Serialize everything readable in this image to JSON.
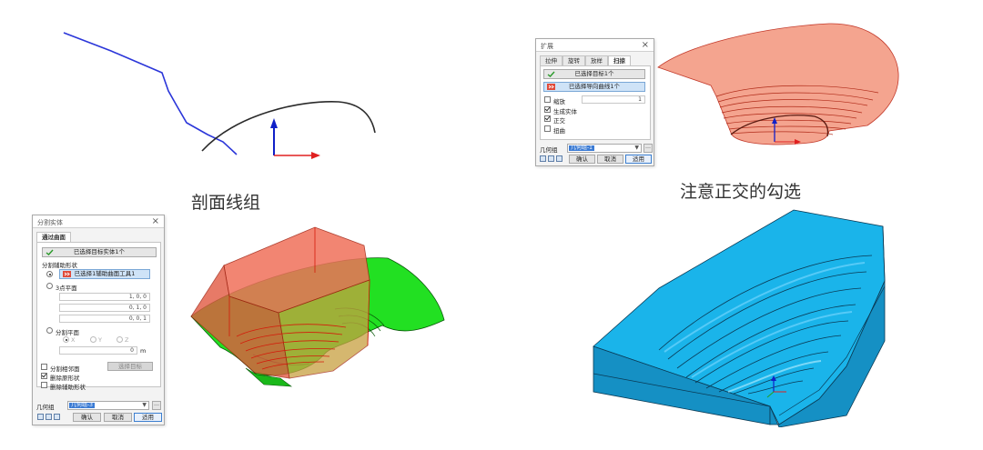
{
  "captions": {
    "profile_lines": "剖面线组",
    "note_orthogonal": "注意正交的勾选"
  },
  "sweep_dialog": {
    "title": "扩展",
    "close": "×",
    "tabs": [
      "拉伸",
      "旋转",
      "放样",
      "扫掠"
    ],
    "active_tab": 3,
    "selected_target": "已选择目标1个",
    "selected_guide": "已选择导向曲线1个",
    "scale_label": "缩放",
    "scale_value": "1",
    "scale_checked": false,
    "solid_label": "生成实体",
    "solid_checked": true,
    "ortho_label": "正交",
    "ortho_checked": true,
    "twist_label": "扭曲",
    "twist_checked": false,
    "geometry_group_label": "几何组",
    "geometry_group_value": "几何组-1",
    "ok": "确认",
    "cancel": "取消",
    "apply": "适用"
  },
  "split_dialog": {
    "title": "分割实体",
    "close": "×",
    "tab": "通过曲面",
    "selected_target": "已选择目标实体1个",
    "aux_shape_legend": "分割辅助形状",
    "selected_aux": "已选择1辅助曲面工具1",
    "three_point_plane": "3点平面",
    "p1": "1, 0, 0",
    "p2": "0, 1, 0",
    "p3": "0, 0, 1",
    "split_plane": "分割平面",
    "axis_x": "X",
    "axis_y": "Y",
    "axis_z": "Z",
    "offset_value": "0",
    "offset_unit": "m",
    "split_adjacent": "分割相邻面",
    "select_target_btn": "选择目标",
    "delete_original": "删除原形状",
    "delete_original_checked": true,
    "delete_aux": "删除辅助形状",
    "delete_aux_checked": false,
    "geometry_group_label": "几何组",
    "geometry_group_value": "几何组-3",
    "ok": "确认",
    "cancel": "取消",
    "apply": "适用"
  },
  "colors": {
    "blue_curve": "#2b36d9",
    "sweep_surface": "#f4a08a",
    "split_box": "#f0705a",
    "green_solid": "#22e022",
    "final_solid": "#1aa8e0"
  }
}
